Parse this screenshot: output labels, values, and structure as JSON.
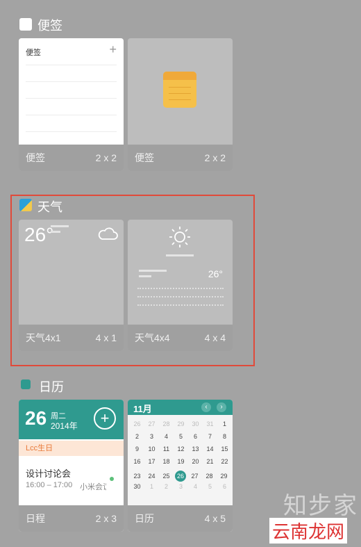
{
  "sections": {
    "notes": {
      "title": "便签",
      "tiles": [
        {
          "name": "便签",
          "size": "2 x 2"
        },
        {
          "name": "便签",
          "size": "2 x 2"
        }
      ],
      "card_title": "便签"
    },
    "weather": {
      "title": "天气",
      "tiles": [
        {
          "name": "天气4x1",
          "size": "4 x 1"
        },
        {
          "name": "天气4x4",
          "size": "4 x 4"
        }
      ],
      "temp_small": "26°",
      "temp_big": "26°"
    },
    "calendar": {
      "title": "日历",
      "tiles": [
        {
          "name": "日程",
          "size": "2 x 3"
        },
        {
          "name": "日历",
          "size": "4 x 5"
        }
      ],
      "day": "26",
      "weekday": "周二",
      "year": "2014年",
      "event_tag": "Lcc生日",
      "event_title": "设计讨论会",
      "event_time": "16:00 – 17:00",
      "event_place": "小米会议",
      "month_label": "11月",
      "weeks": [
        [
          "26",
          "27",
          "28",
          "29",
          "30",
          "31",
          "1"
        ],
        [
          "2",
          "3",
          "4",
          "5",
          "6",
          "7",
          "8"
        ],
        [
          "9",
          "10",
          "11",
          "12",
          "13",
          "14",
          "15"
        ],
        [
          "16",
          "17",
          "18",
          "19",
          "20",
          "21",
          "22"
        ],
        [
          "23",
          "24",
          "25",
          "26",
          "27",
          "28",
          "29"
        ],
        [
          "30",
          "1",
          "2",
          "3",
          "4",
          "5",
          "6"
        ]
      ]
    }
  },
  "watermark": {
    "line1": "知步家",
    "line2": "云南龙网"
  },
  "colors": {
    "background": "#a3a3a3",
    "highlight": "#e04a3a",
    "calendar_accent": "#2f9a8f"
  }
}
